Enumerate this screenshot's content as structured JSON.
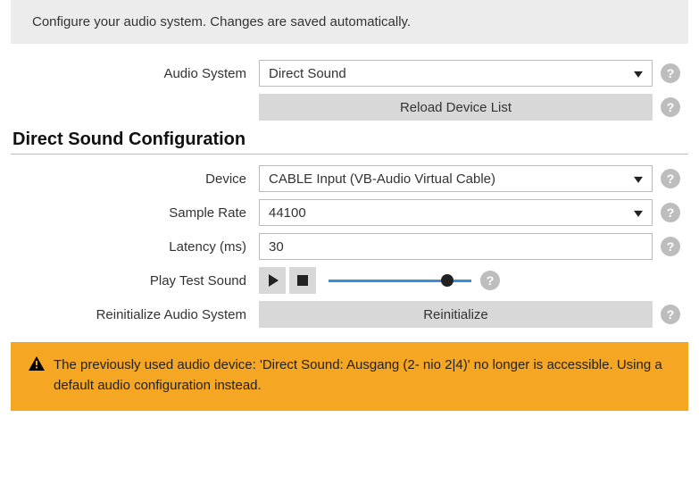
{
  "intro": "Configure your audio system. Changes are saved automatically.",
  "audio_system": {
    "label": "Audio System",
    "value": "Direct Sound",
    "reload_label": "Reload Device List"
  },
  "section_title": "Direct Sound Configuration",
  "device": {
    "label": "Device",
    "value": "CABLE Input (VB-Audio Virtual Cable)"
  },
  "sample_rate": {
    "label": "Sample Rate",
    "value": "44100"
  },
  "latency": {
    "label": "Latency (ms)",
    "value": "30"
  },
  "test_sound": {
    "label": "Play Test Sound",
    "slider_position_pct": 83
  },
  "reinit": {
    "label": "Reinitialize Audio System",
    "button": "Reinitialize"
  },
  "warning": "The previously used audio device: 'Direct Sound: Ausgang (2- nio 2|4)' no longer is accessible. Using a default audio configuration instead.",
  "help_glyph": "?"
}
